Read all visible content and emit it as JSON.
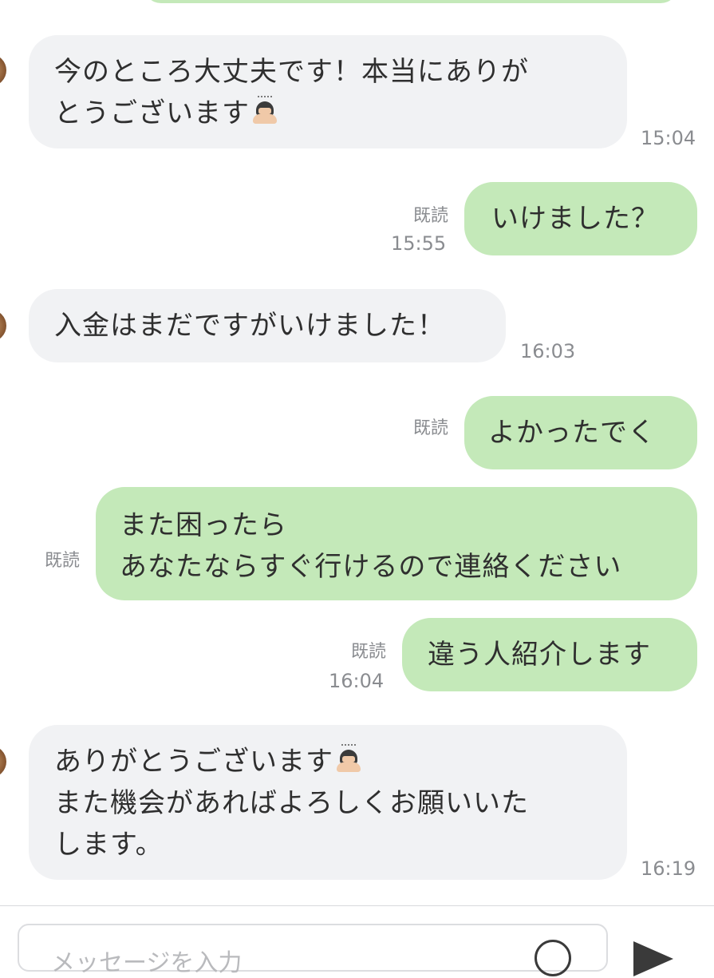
{
  "messages": [
    {
      "side": "in",
      "lines": [
        "今のところ大丈夫です！本当にありが",
        "とうございます"
      ],
      "emoji": "person-bowing-emoji",
      "time": "15:04"
    },
    {
      "side": "out",
      "lines": [
        "いけました？"
      ],
      "read": "既読",
      "time": "15:55"
    },
    {
      "side": "in",
      "lines": [
        "入金はまだですがいけました！"
      ],
      "time": "16:03"
    },
    {
      "side": "out",
      "lines": [
        "よかったでく"
      ],
      "read": "既読"
    },
    {
      "side": "out",
      "lines": [
        "また困ったら",
        "あなたならすぐ行けるので連絡ください"
      ],
      "read": "既読"
    },
    {
      "side": "out",
      "lines": [
        "違う人紹介します"
      ],
      "read": "既読",
      "time": "16:04"
    },
    {
      "side": "in",
      "lines": [
        "ありがとうございます",
        "また機会があればよろしくお願いいた",
        "します。"
      ],
      "emoji": "person-bowing-emoji",
      "time": "16:19"
    }
  ],
  "input": {
    "placeholder": "メッセージを入力"
  },
  "colors": {
    "incoming_bubble": "#f1f2f4",
    "outgoing_bubble": "#c4e9b9",
    "meta_text": "#8a8c90"
  }
}
